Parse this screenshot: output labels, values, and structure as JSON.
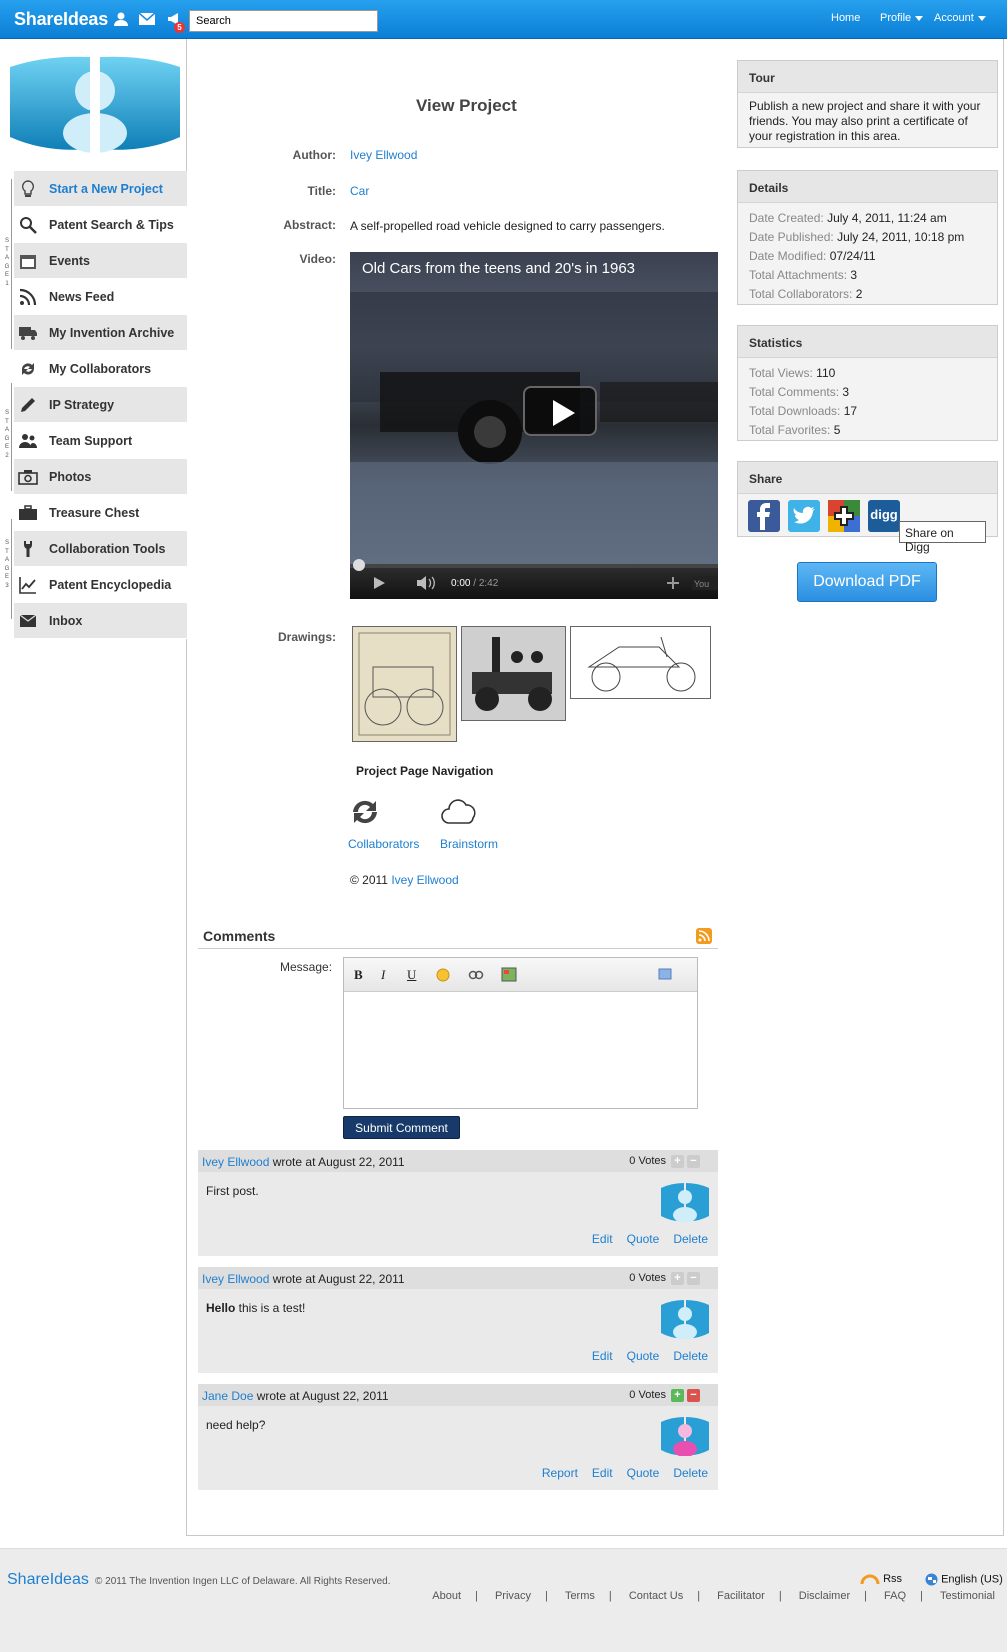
{
  "app": {
    "logo": "ShareIdeas",
    "notification_count": "5"
  },
  "search": {
    "value": "Search"
  },
  "topnav": {
    "home": "Home",
    "profile": "Profile",
    "account": "Account"
  },
  "sidebar": {
    "items": [
      {
        "label": "Start a New Project",
        "icon": "lightbulb-icon"
      },
      {
        "label": "Patent Search & Tips",
        "icon": "magnifier-icon"
      },
      {
        "label": "Events",
        "icon": "calendar-icon"
      },
      {
        "label": "News Feed",
        "icon": "rss-icon"
      },
      {
        "label": "My Invention Archive",
        "icon": "truck-icon"
      },
      {
        "label": "My Collaborators",
        "icon": "refresh-icon"
      },
      {
        "label": "IP Strategy",
        "icon": "pencil-icon"
      },
      {
        "label": "Team Support",
        "icon": "users-icon"
      },
      {
        "label": "Photos",
        "icon": "camera-icon"
      },
      {
        "label": "Treasure Chest",
        "icon": "briefcase-icon"
      },
      {
        "label": "Collaboration Tools",
        "icon": "wrench-icon"
      },
      {
        "label": "Patent Encyclopedia",
        "icon": "chart-icon"
      },
      {
        "label": "Inbox",
        "icon": "inbox-icon"
      }
    ],
    "stages": [
      "STAGE 1",
      "STAGE 2",
      "STAGE 3"
    ]
  },
  "project": {
    "page_title": "View Project",
    "author_label": "Author:",
    "author": "Ivey Ellwood",
    "title_label": "Title:",
    "title": "Car",
    "abstract_label": "Abstract:",
    "abstract": "A self-propelled road vehicle designed to carry passengers.",
    "video_label": "Video:",
    "video_title": "Old Cars from the teens and 20's in 1963",
    "video_time_current": "0:00",
    "video_time_total": "2:42",
    "video_progress": 0,
    "drawings_label": "Drawings:"
  },
  "project_nav": {
    "title": "Project Page Navigation",
    "collaborators": "Collaborators",
    "brainstorm": "Brainstorm",
    "copyright_prefix": "© 2011",
    "copyright_author": "Ivey Ellwood"
  },
  "comments": {
    "title": "Comments",
    "message_label": "Message:",
    "submit": "Submit Comment",
    "list": [
      {
        "author": "Ivey Ellwood",
        "meta": "wrote at August 22, 2011",
        "votes": "0 Votes",
        "body_bold": "",
        "body": "First post.",
        "actions": [
          "Edit",
          "Quote",
          "Delete"
        ]
      },
      {
        "author": "Ivey Ellwood",
        "meta": "wrote at August 22, 2011",
        "votes": "0 Votes",
        "body_bold": "Hello",
        "body": " this is a test!",
        "actions": [
          "Edit",
          "Quote",
          "Delete"
        ]
      },
      {
        "author": "Jane Doe",
        "meta": "wrote at August 22, 2011",
        "votes": "0 Votes",
        "body_bold": "",
        "body": "need help?",
        "actions": [
          "Report",
          "Edit",
          "Quote",
          "Delete"
        ]
      }
    ]
  },
  "tour": {
    "title": "Tour",
    "text": "Publish a new project and share it with your friends. You may also print a certificate of your registration in this area."
  },
  "details": {
    "title": "Details",
    "rows": [
      {
        "k": "Date Created:",
        "v": "July 4, 2011, 11:24 am"
      },
      {
        "k": "Date Published:",
        "v": "July 24, 2011, 10:18 pm"
      },
      {
        "k": "Date Modified:",
        "v": "07/24/11"
      },
      {
        "k": "Total Attachments:",
        "v": "3"
      },
      {
        "k": "Total Collaborators:",
        "v": "2"
      }
    ]
  },
  "statistics": {
    "title": "Statistics",
    "rows": [
      {
        "k": "Total Views:",
        "v": "110"
      },
      {
        "k": "Total Comments:",
        "v": "3"
      },
      {
        "k": "Total Downloads:",
        "v": "17"
      },
      {
        "k": "Total Favorites:",
        "v": "5"
      }
    ]
  },
  "share": {
    "title": "Share",
    "tooltip": "Share on Digg",
    "digg": "digg",
    "download": "Download PDF"
  },
  "footer": {
    "logo": "ShareIdeas",
    "copyright": "© 2011 The Invention Ingen LLC of Delaware. All Rights Reserved.",
    "rss": "Rss",
    "language": "English (US)",
    "links": [
      "About",
      "Privacy",
      "Terms",
      "Contact Us",
      "Facilitator",
      "Disclaimer",
      "FAQ",
      "Testimonial"
    ]
  },
  "colors": {
    "accent": "#1e7fd0",
    "topbar": "#1591e4",
    "submit": "#173a6a"
  }
}
